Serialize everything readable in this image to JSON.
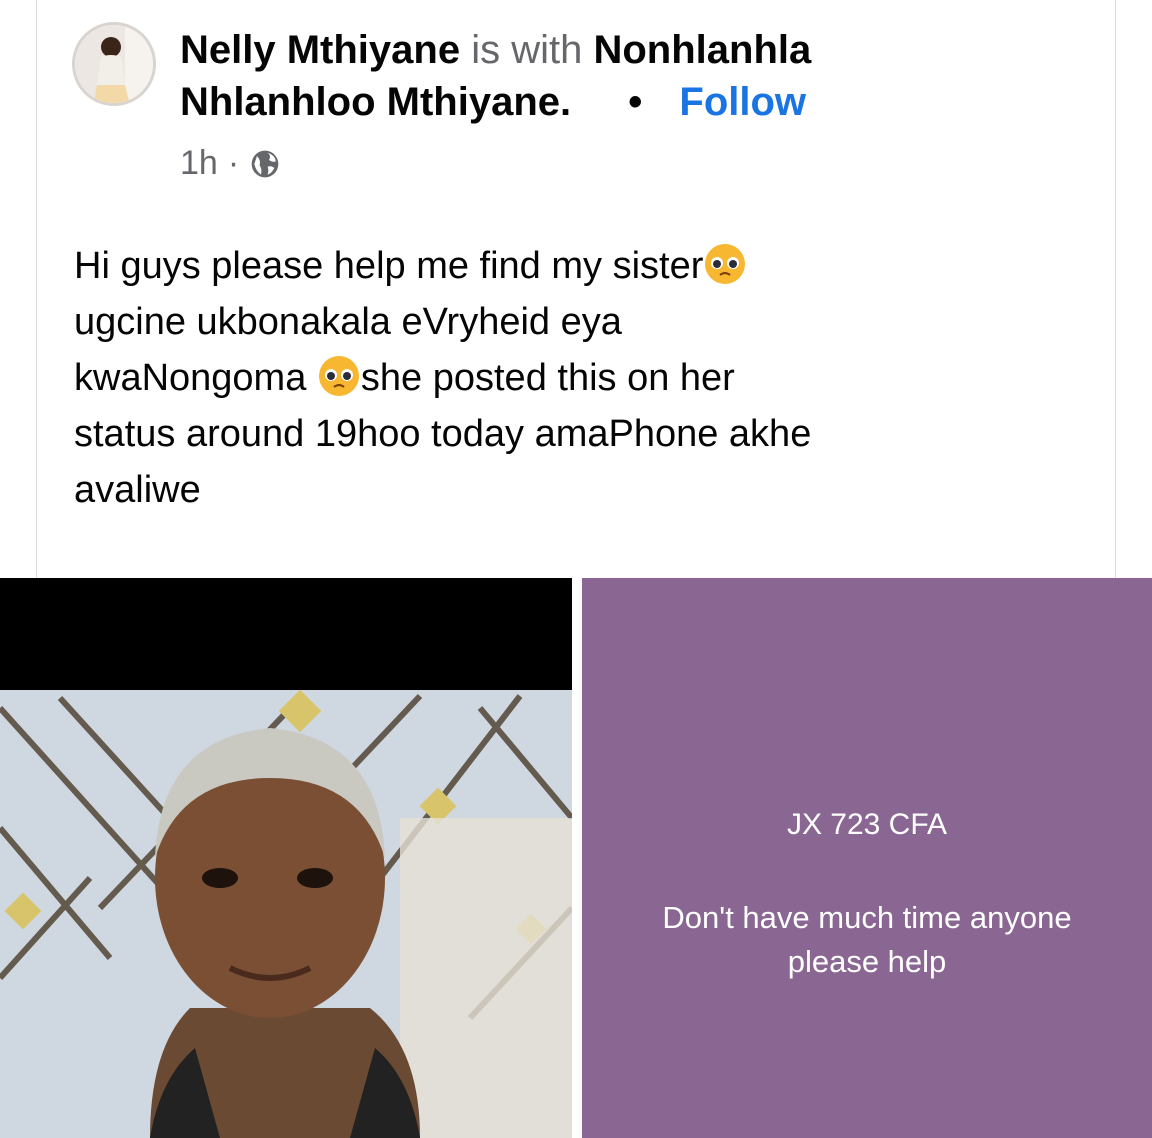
{
  "post": {
    "author": "Nelly Mthiyane",
    "with_text": "is with",
    "tagged": "Nonhlanhla",
    "tagged_line2": "Nhlanhloo Mthiyane.",
    "separator": "•",
    "follow_label": "Follow",
    "time": "1h",
    "dot": "·",
    "audience_icon": "globe-icon",
    "text_lines": [
      "Hi guys please help me find my sister",
      "ugcine ukbonakala eVryheid eya",
      "kwaNongoma ",
      "she posted this on her",
      "status around 19hoo today amaPhone akhe",
      "avaliwe"
    ]
  },
  "images": {
    "status": {
      "plate": "JX 723 CFA",
      "message": "Don't have much time anyone please help",
      "background": "#8a6792"
    }
  },
  "colors": {
    "link": "#1b74e4",
    "muted": "#65676b",
    "text": "#050505"
  }
}
